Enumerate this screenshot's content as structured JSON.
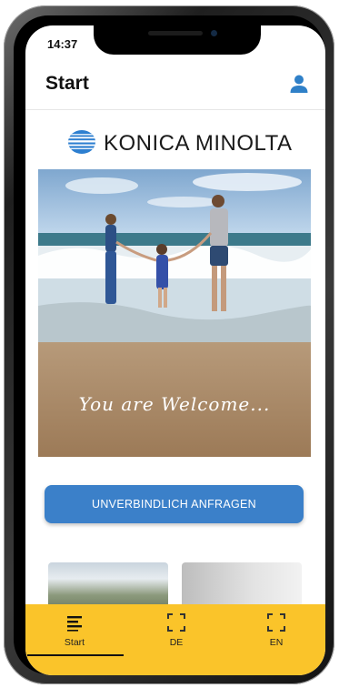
{
  "status_bar": {
    "time": "14:37"
  },
  "header": {
    "title": "Start"
  },
  "brand": {
    "name": "KONICA MINOLTA"
  },
  "hero": {
    "caption": "You are Welcome..."
  },
  "cta": {
    "label": "UNVERBINDLICH ANFRAGEN"
  },
  "tabbar": {
    "tabs": [
      {
        "label": "Start",
        "icon": "menu-lines-icon",
        "active": true
      },
      {
        "label": "DE",
        "icon": "scan-frame-icon",
        "active": false
      },
      {
        "label": "EN",
        "icon": "scan-frame-icon",
        "active": false
      }
    ]
  },
  "colors": {
    "accent": "#3b80c9",
    "tabbar": "#fac42a",
    "user_icon": "#2f80c8"
  }
}
